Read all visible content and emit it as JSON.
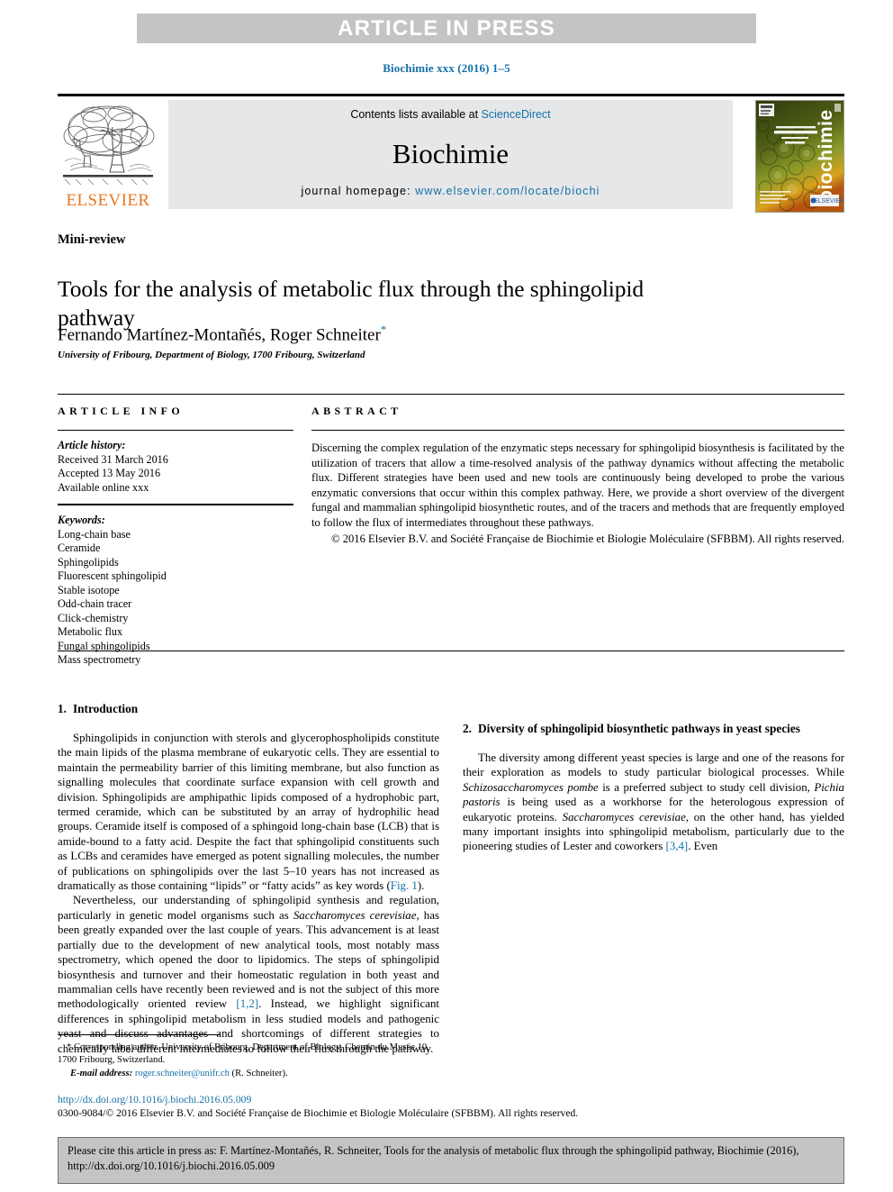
{
  "banner": {
    "text": "ARTICLE IN PRESS"
  },
  "running_head": "Biochimie xxx (2016) 1–5",
  "masthead": {
    "contents_prefix": "Contents lists available at ",
    "contents_link": "ScienceDirect",
    "journal_name": "Biochimie",
    "homepage_prefix": "journal homepage: ",
    "homepage_link": "www.elsevier.com/locate/biochi",
    "publisher_wordmark": "ELSEVIER",
    "cover_title": "biochimie"
  },
  "article": {
    "doctype": "Mini-review",
    "title": "Tools for the analysis of metabolic flux through the sphingolipid pathway",
    "authors": "Fernando Martínez-Montañés, Roger Schneiter",
    "corresponding_marker": "*",
    "affiliation": "University of Fribourg, Department of Biology, 1700 Fribourg, Switzerland"
  },
  "info": {
    "heading": "ARTICLE INFO",
    "history_label": "Article history:",
    "history": [
      "Received 31 March 2016",
      "Accepted 13 May 2016",
      "Available online xxx"
    ],
    "keywords_label": "Keywords:",
    "keywords": [
      "Long-chain base",
      "Ceramide",
      "Sphingolipids",
      "Fluorescent sphingolipid",
      "Stable isotope",
      "Odd-chain tracer",
      "Click-chemistry",
      "Metabolic flux",
      "Fungal sphingolipids",
      "Mass spectrometry"
    ]
  },
  "abstract": {
    "heading": "ABSTRACT",
    "text": "Discerning the complex regulation of the enzymatic steps necessary for sphingolipid biosynthesis is facilitated by the utilization of tracers that allow a time-resolved analysis of the pathway dynamics without affecting the metabolic flux. Different strategies have been used and new tools are continuously being developed to probe the various enzymatic conversions that occur within this complex pathway. Here, we provide a short overview of the divergent fungal and mammalian sphingolipid biosynthetic routes, and of the tracers and methods that are frequently employed to follow the flux of intermediates throughout these pathways.",
    "copyright": "© 2016 Elsevier B.V. and Société Française de Biochimie et Biologie Moléculaire (SFBBM). All rights reserved."
  },
  "sections": {
    "intro": {
      "number": "1.",
      "title": "Introduction",
      "para1_a": "Sphingolipids in conjunction with sterols and glycerophospholipids constitute the main lipids of the plasma membrane of eukaryotic cells. They are essential to maintain the permeability barrier of this limiting membrane, but also function as signalling molecules that coordinate surface expansion with cell growth and division. Sphingolipids are amphipathic lipids composed of a hydrophobic part, termed ceramide, which can be substituted by an array of hydrophilic head groups. Ceramide itself is composed of a sphingoid long-chain base (LCB) that is amide-bound to a fatty acid. Despite the fact that sphingolipid constituents such as LCBs and ceramides have emerged as potent signalling molecules, the number of publications on sphingolipids over the last 5–10 years has not increased as dramatically as those containing “lipids” or “fatty acids” as key words (",
      "para1_ref": "Fig. 1",
      "para1_b": ").",
      "para2_a": "Nevertheless, our understanding of sphingolipid synthesis and regulation, particularly in genetic model organisms such as ",
      "para2_em": "Saccharomyces cerevisiae",
      "para2_b": ", has been greatly expanded over the last couple of years. This advancement is at least partially due to the development of new analytical tools, most notably mass spectrometry, which opened the door to lipidomics. The steps of sphingolipid biosynthesis and turnover and their homeostatic regulation in both yeast and mammalian cells have recently been reviewed and is not the subject of this more methodologically oriented review ",
      "para2_ref": "[1,2]",
      "para2_c": ". Instead, we highlight significant differences in sphingolipid metabolism in less studied models and pathogenic yeast and discuss advantages and shortcomings of different strategies to chemically label different intermediates to follow their flux through the pathway."
    },
    "diversity": {
      "number": "2.",
      "title": "Diversity of sphingolipid biosynthetic pathways in yeast species",
      "para_a": "The diversity among different yeast species is large and one of the reasons for their exploration as models to study particular biological processes. While ",
      "em1": "Schizosaccharomyces pombe",
      "para_b": " is a preferred subject to study cell division, ",
      "em2": "Pichia pastoris",
      "para_c": " is being used as a workhorse for the heterologous expression of eukaryotic proteins. ",
      "em3": "Saccharomyces cerevisiae",
      "para_d": ", on the other hand, has yielded many important insights into sphingolipid metabolism, particularly due to the pioneering studies of Lester and coworkers ",
      "para_ref": "[3,4]",
      "para_e": ". Even"
    }
  },
  "footnotes": {
    "corresponding": "* Corresponding author. University of Fribourg, Department of Biology, Chemin du Musée 10, 1700 Fribourg, Switzerland.",
    "email_label": "E-mail address:",
    "email": "roger.schneiter@unifr.ch",
    "email_suffix": "(R. Schneiter)."
  },
  "doi": {
    "url": "http://dx.doi.org/10.1016/j.biochi.2016.05.009",
    "issn_line": "0300-9084/© 2016 Elsevier B.V. and Société Française de Biochimie et Biologie Moléculaire (SFBBM). All rights reserved."
  },
  "citation_box": {
    "text": "Please cite this article in press as: F. Martínez-Montañés, R. Schneiter, Tools for the analysis of metabolic flux through the sphingolipid pathway, Biochimie (2016), http://dx.doi.org/10.1016/j.biochi.2016.05.009"
  },
  "colors": {
    "link": "#1571a8",
    "banner_gray": "#c3c4c6",
    "band_gray": "#e6e7e8",
    "elsevier_orange": "#e87722"
  }
}
